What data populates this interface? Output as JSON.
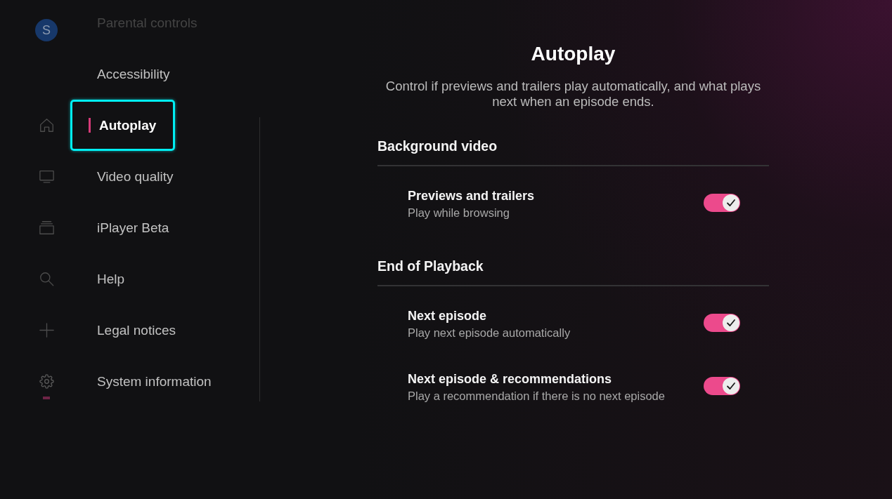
{
  "rail": {
    "avatar": "S",
    "items": [
      {
        "kind": "home",
        "selected": false
      },
      {
        "kind": "tv",
        "selected": false
      },
      {
        "kind": "stack",
        "selected": false
      },
      {
        "kind": "search",
        "selected": false
      },
      {
        "kind": "plus",
        "selected": false
      },
      {
        "kind": "gear",
        "selected": true
      }
    ]
  },
  "menu": [
    {
      "label": "Parental controls",
      "selected": false,
      "dimmed": true
    },
    {
      "label": "Accessibility",
      "selected": false,
      "dimmed": false
    },
    {
      "label": "Autoplay",
      "selected": true,
      "dimmed": false
    },
    {
      "label": "Video quality",
      "selected": false,
      "dimmed": false
    },
    {
      "label": "iPlayer Beta",
      "selected": false,
      "dimmed": false
    },
    {
      "label": "Help",
      "selected": false,
      "dimmed": false
    },
    {
      "label": "Legal notices",
      "selected": false,
      "dimmed": false
    },
    {
      "label": "System information",
      "selected": false,
      "dimmed": false
    }
  ],
  "page": {
    "title": "Autoplay",
    "description": "Control if previews and trailers play automatically, and what plays next when an episode ends."
  },
  "sections": [
    {
      "heading": "Background video",
      "rows": [
        {
          "title": "Previews and trailers",
          "subtitle": "Play while browsing",
          "on": true
        }
      ]
    },
    {
      "heading": "End of Playback",
      "rows": [
        {
          "title": "Next episode",
          "subtitle": "Play next episode automatically",
          "on": true
        },
        {
          "title": "Next episode & recommendations",
          "subtitle": "Play a recommendation if there is no next episode",
          "on": true
        }
      ]
    }
  ]
}
